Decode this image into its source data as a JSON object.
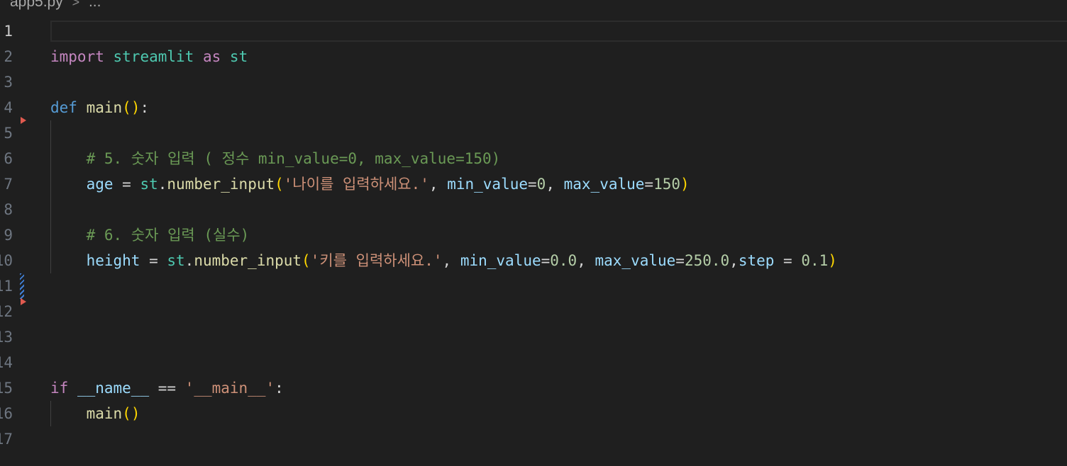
{
  "breadcrumb": {
    "file": "app5.py",
    "separator": ">",
    "ellipsis": "..."
  },
  "line_numbers": [
    "1",
    "2",
    "3",
    "4",
    "5",
    "6",
    "7",
    "8",
    "9",
    "10",
    "11",
    "12",
    "13",
    "14",
    "15",
    "16",
    "17"
  ],
  "code": {
    "l2": {
      "import": "import",
      "module": "streamlit",
      "as": "as",
      "alias": "st"
    },
    "l4": {
      "def": "def",
      "name": "main",
      "open": "(",
      "close": ")",
      "colon": ":"
    },
    "l6": {
      "comment": "# 5. 숫자 입력 ( 정수 min_value=0, max_value=150)"
    },
    "l7": {
      "var": "age",
      "eq": " = ",
      "obj": "st",
      "dot": ".",
      "fn": "number_input",
      "open": "(",
      "str": "'나이를 입력하세요.'",
      "comma1": ", ",
      "p1": "min_value",
      "eq1": "=",
      "v1": "0",
      "comma2": ", ",
      "p2": "max_value",
      "eq2": "=",
      "v2": "150",
      "close": ")"
    },
    "l9": {
      "comment": "# 6. 숫자 입력 (실수)"
    },
    "l10": {
      "var": "height",
      "eq": " = ",
      "obj": "st",
      "dot": ".",
      "fn": "number_input",
      "open": "(",
      "str": "'키를 입력하세요.'",
      "comma1": ", ",
      "p1": "min_value",
      "eq1": "=",
      "v1": "0.0",
      "comma2": ", ",
      "p2": "max_value",
      "eq2": "=",
      "v2": "250.0",
      "comma3": ",",
      "p3": "step",
      "eq3": " = ",
      "v3": "0.1",
      "close": ")"
    },
    "l15": {
      "if": "if",
      "name": "__name__",
      "op": " == ",
      "str": "'__main__'",
      "colon": ":"
    },
    "l16": {
      "fn": "main",
      "open": "(",
      "close": ")"
    }
  },
  "colors": {
    "background": "#1f1f1f",
    "keyword_control": "#c586c0",
    "keyword_def": "#569cd6",
    "module": "#4ec9b0",
    "function": "#dcdcaa",
    "bracket": "#ffd700",
    "string": "#ce9178",
    "number": "#b5cea8",
    "parameter": "#9cdcfe",
    "comment": "#6a9955"
  }
}
